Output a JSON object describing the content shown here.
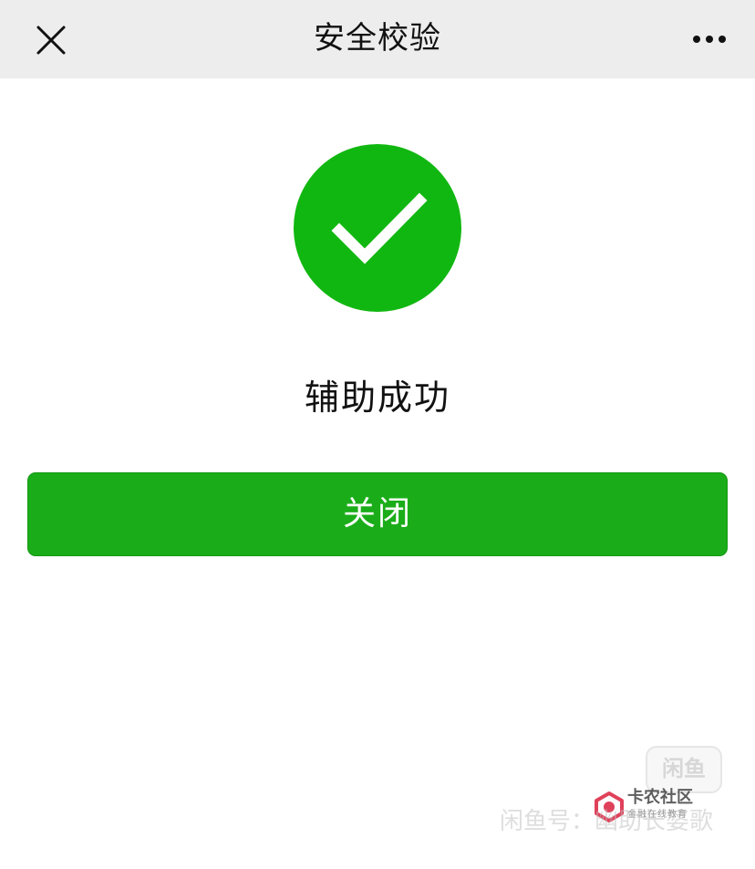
{
  "navbar": {
    "title": "安全校验",
    "close_icon": "close-icon",
    "more_icon": "more-icon"
  },
  "result": {
    "icon": "success-check-icon",
    "icon_color": "#11b711",
    "title": "辅助成功"
  },
  "actions": {
    "close_label": "关闭",
    "button_color": "#1aad19"
  },
  "watermark": {
    "box_text": "闲鱼",
    "text": "闲鱼号：幽助长婆歌",
    "brand_name": "卡农社区",
    "brand_sub": "金融在线教育"
  }
}
